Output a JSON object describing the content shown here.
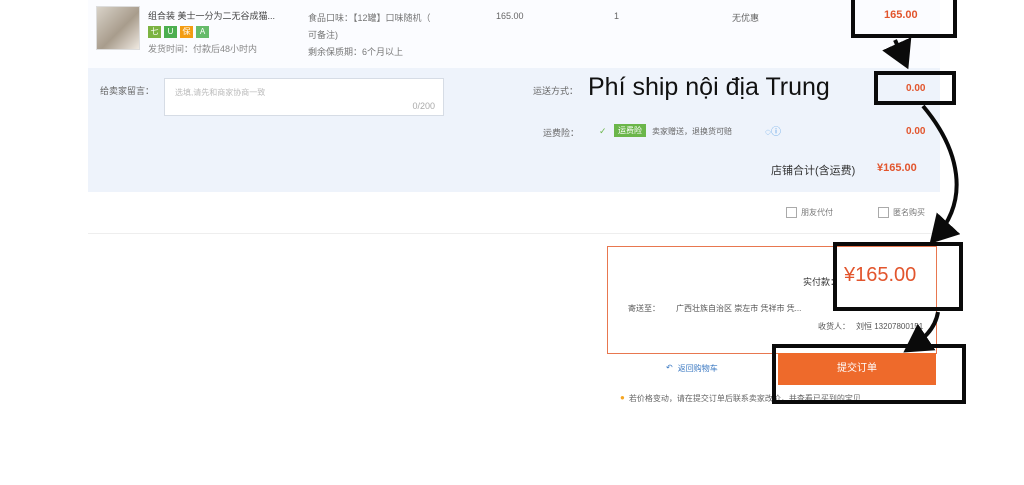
{
  "product": {
    "title": "组合装 美士一分为二无谷成猫...",
    "badges": [
      "七",
      "U",
      "保",
      "A"
    ],
    "ship_time": "发货时间：付款后48小时内",
    "attr_flavor": "食品口味：【12罐】口味随机（",
    "attr_flavor_cont": "可备注)",
    "attr_shelf": "剩余保质期：6个月以上",
    "unit_price": "165.00",
    "quantity": "1",
    "discount": "无优惠",
    "total": "165.00"
  },
  "message": {
    "label": "给卖家留言：",
    "placeholder": "选填,请先和商家协商一致",
    "counter": "0/200"
  },
  "shipping": {
    "label": "运送方式：",
    "value": "0.00",
    "insurance_label": "运费险：",
    "insurance_tag": "运费险",
    "insurance_text": "卖家赠送，退换货可赔",
    "insurance_value": "0.00"
  },
  "store_total": {
    "label": "店铺合计(含运费)",
    "value": "¥165.00"
  },
  "options": {
    "friend_pay": "朋友代付",
    "anonymous": "匿名购买"
  },
  "payment": {
    "label": "实付款：",
    "amount": "¥165.00",
    "address_label": "寄送至：",
    "address": "广西壮族自治区 崇左市 凭祥市 凭...",
    "receiver_label": "收货人：",
    "receiver": "刘恒 13207800151"
  },
  "actions": {
    "back": "返回购物车",
    "submit": "提交订单",
    "notice": "若价格变动，请在提交订单后联系卖家改价，并查看已买到的宝贝"
  },
  "annotation": {
    "text": "Phí ship nội địa Trung"
  },
  "colors": {
    "accent": "#e2552d",
    "button": "#ee6a2b",
    "panel": "#eef3fb"
  }
}
